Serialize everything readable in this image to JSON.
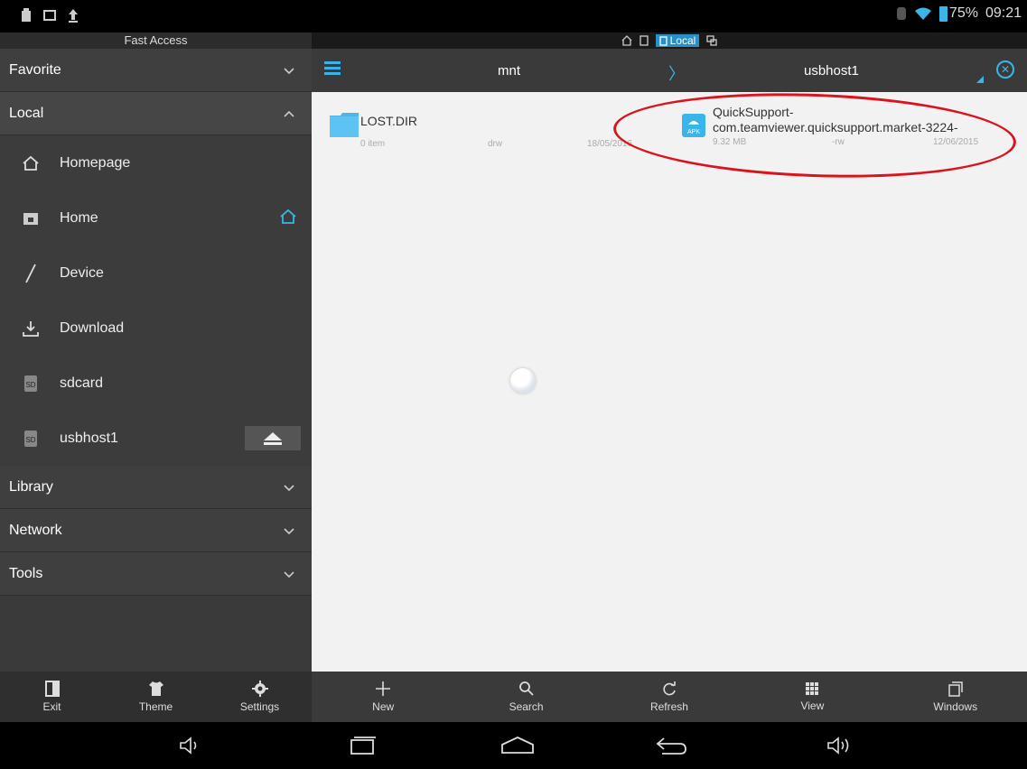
{
  "status": {
    "battery": "75%",
    "time": "09:21"
  },
  "drawer": {
    "title": "Fast Access",
    "sections": {
      "favorite": "Favorite",
      "local": "Local",
      "library": "Library",
      "network": "Network",
      "tools": "Tools"
    },
    "items": [
      {
        "label": "Homepage",
        "icon": "house-icon"
      },
      {
        "label": "Home",
        "icon": "folder-home-icon"
      },
      {
        "label": "Device",
        "icon": "slash-icon"
      },
      {
        "label": "Download",
        "icon": "download-icon"
      },
      {
        "label": "sdcard",
        "icon": "sd-icon"
      },
      {
        "label": "usbhost1",
        "icon": "sd-icon"
      }
    ],
    "sd_badge": "SD",
    "tools": {
      "exit": "Exit",
      "theme": "Theme",
      "settings": "Settings"
    }
  },
  "topbar": {
    "local_label": "Local"
  },
  "path": {
    "crumb1": "mnt",
    "crumb2": "usbhost1"
  },
  "files": [
    {
      "name": "LOST.DIR",
      "count": "0 item",
      "perm": "drw",
      "date": "18/05/2016"
    },
    {
      "name_line1": "QuickSupport-",
      "name_line2": "com.teamviewer.quicksupport.market-3224-",
      "size": "9.32 MB",
      "perm": "-rw",
      "date": "12/06/2015",
      "badge": "APK"
    }
  ],
  "bottom": {
    "new": "New",
    "search": "Search",
    "refresh": "Refresh",
    "view": "View",
    "windows": "Windows"
  },
  "colors": {
    "accent": "#39b5ea",
    "annotation": "#d9141f"
  }
}
